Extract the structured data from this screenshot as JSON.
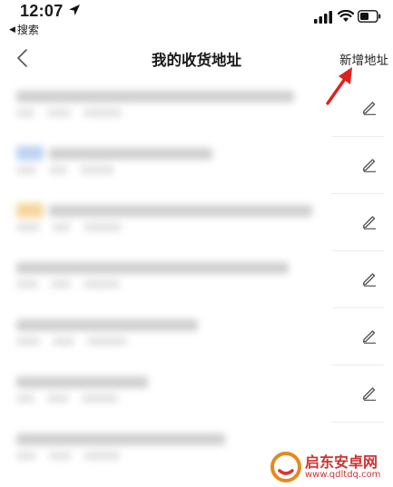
{
  "status_bar": {
    "time": "12:07",
    "back_to_app": "搜索"
  },
  "nav": {
    "title": "我的收货地址",
    "add_label": "新增地址"
  },
  "addresses": [
    {
      "tag_color": ""
    },
    {
      "tag_color": "#bcd3f3"
    },
    {
      "tag_color": "#f6d59a"
    },
    {
      "tag_color": ""
    },
    {
      "tag_color": ""
    },
    {
      "tag_color": ""
    },
    {
      "tag_color": ""
    }
  ],
  "watermark": {
    "name": "启东安卓网",
    "url": "www.qdltdq.com"
  },
  "colors": {
    "annotation_arrow": "#e0201c",
    "watermark": "#cc3333"
  }
}
